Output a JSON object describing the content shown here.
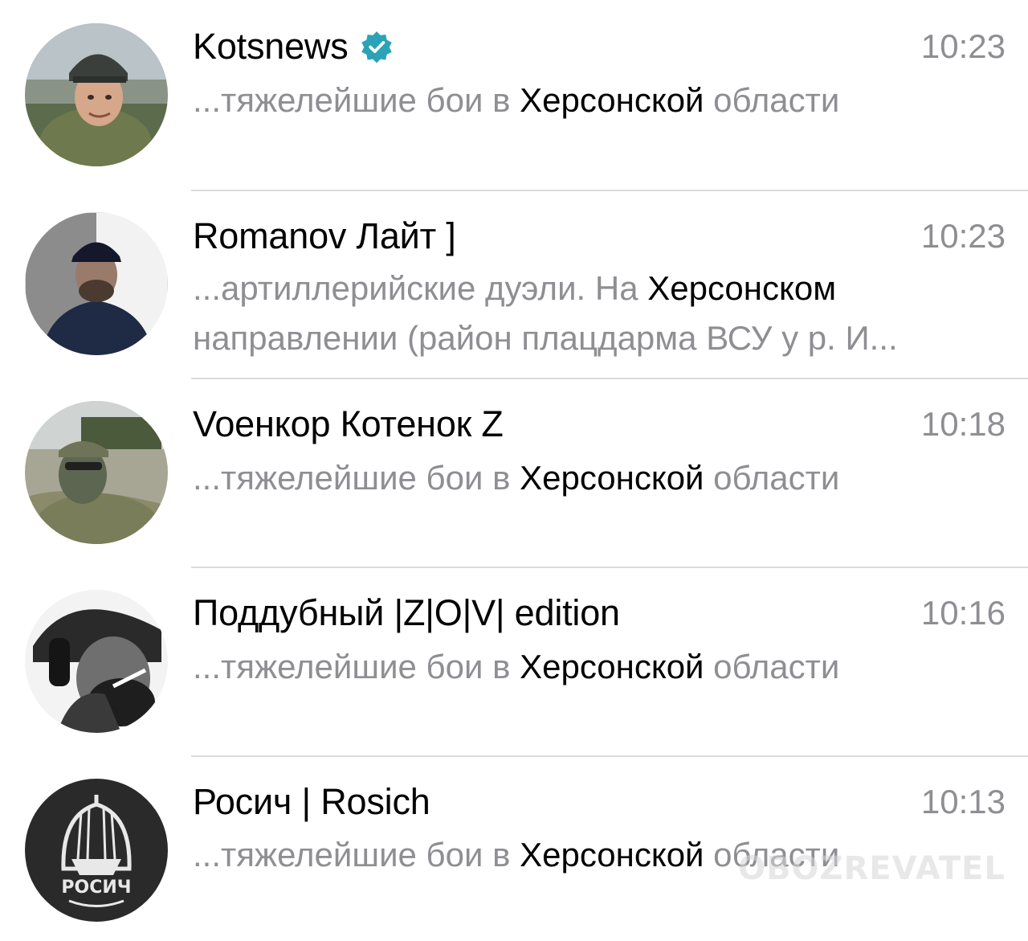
{
  "chats": [
    {
      "name": "Kotsnews",
      "verified": true,
      "time": "10:23",
      "preview_line1": {
        "pre": "...тяжелейшие бои в ",
        "highlight": "Херсонской",
        "post": " области"
      },
      "preview_line2": ""
    },
    {
      "name": "Romanov Лайт ]",
      "verified": false,
      "time": "10:23",
      "preview_line1": {
        "pre": "...артиллерийские дуэли. На ",
        "highlight": "Херсонском",
        "post": ""
      },
      "preview_line2": "направлении (район плацдарма ВСУ у р. И..."
    },
    {
      "name": "Voенкор Котенок Z",
      "verified": false,
      "time": "10:18",
      "preview_line1": {
        "pre": "...тяжелейшие бои в ",
        "highlight": "Херсонской",
        "post": " области"
      },
      "preview_line2": ""
    },
    {
      "name": "Поддубный |Z|O|V| edition",
      "verified": false,
      "time": "10:16",
      "preview_line1": {
        "pre": "...тяжелейшие бои в ",
        "highlight": "Херсонской",
        "post": " области"
      },
      "preview_line2": ""
    },
    {
      "name": "Росич | Rosich",
      "verified": false,
      "time": "10:13",
      "preview_line1": {
        "pre": "...тяжелейшие бои в ",
        "highlight": "Херсонской",
        "post": " области"
      },
      "preview_line2": "",
      "avatar_text": "РОСИЧ"
    }
  ],
  "watermark": "OBOZREVATEL",
  "colors": {
    "text_primary": "#000000",
    "text_secondary": "#8e8e93",
    "separator": "#dcdcdc",
    "verified_badge": "#2aa3b8"
  },
  "icons": {
    "verified": "verified-badge-icon"
  }
}
